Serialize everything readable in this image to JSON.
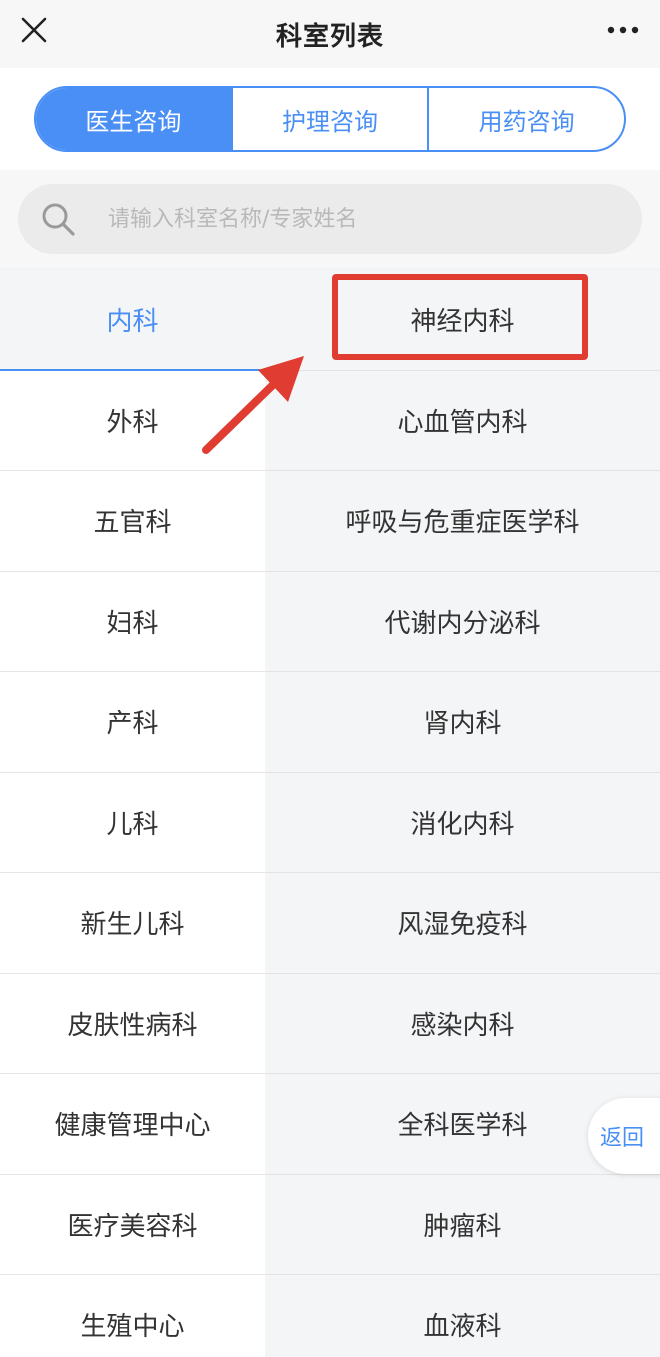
{
  "header": {
    "title": "科室列表",
    "close_icon": "close-icon",
    "more_icon": "more-dots-icon"
  },
  "tabs": [
    {
      "label": "医生咨询",
      "active": true
    },
    {
      "label": "护理咨询",
      "active": false
    },
    {
      "label": "用药咨询",
      "active": false
    }
  ],
  "search": {
    "placeholder": "请输入科室名称/专家姓名",
    "icon": "search-icon"
  },
  "categories": [
    "内科",
    "外科",
    "五官科",
    "妇科",
    "产科",
    "儿科",
    "新生儿科",
    "皮肤性病科",
    "健康管理中心",
    "医疗美容科",
    "生殖中心"
  ],
  "selected_category": "内科",
  "departments": [
    "神经内科",
    "心血管内科",
    "呼吸与危重症医学科",
    "代谢内分泌科",
    "肾内科",
    "消化内科",
    "风湿免疫科",
    "感染内科",
    "全科医学科",
    "肿瘤科",
    "血液科"
  ],
  "return_button": "返回",
  "colors": {
    "accent": "#4a8ff5",
    "annotation": "#e03c31"
  }
}
